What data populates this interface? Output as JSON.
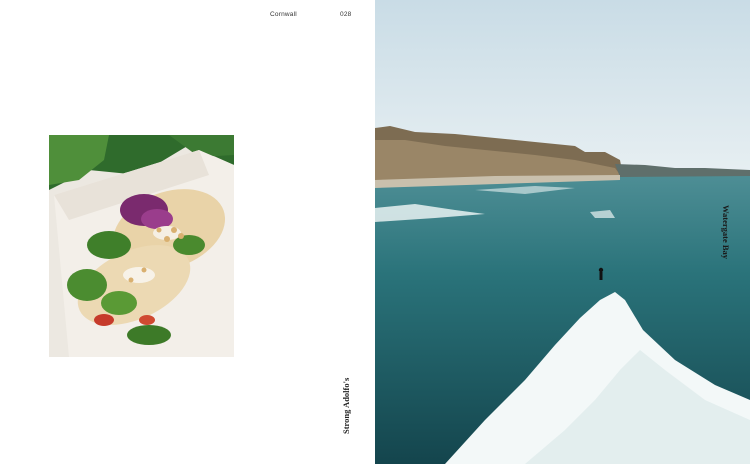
{
  "left_page": {
    "running_title": "Cornwall",
    "page_number": "028",
    "caption": "Strong Adolfo's"
  },
  "right_page": {
    "caption": "Watergate Bay"
  },
  "colors": {
    "sky": "#d9e6ee",
    "sea": "#1d5c62",
    "cliff": "#8c7a5e",
    "foam": "#ffffff"
  },
  "images": {
    "left": "food-photo-tacos",
    "right": "aerial-surf-beach-photo"
  }
}
